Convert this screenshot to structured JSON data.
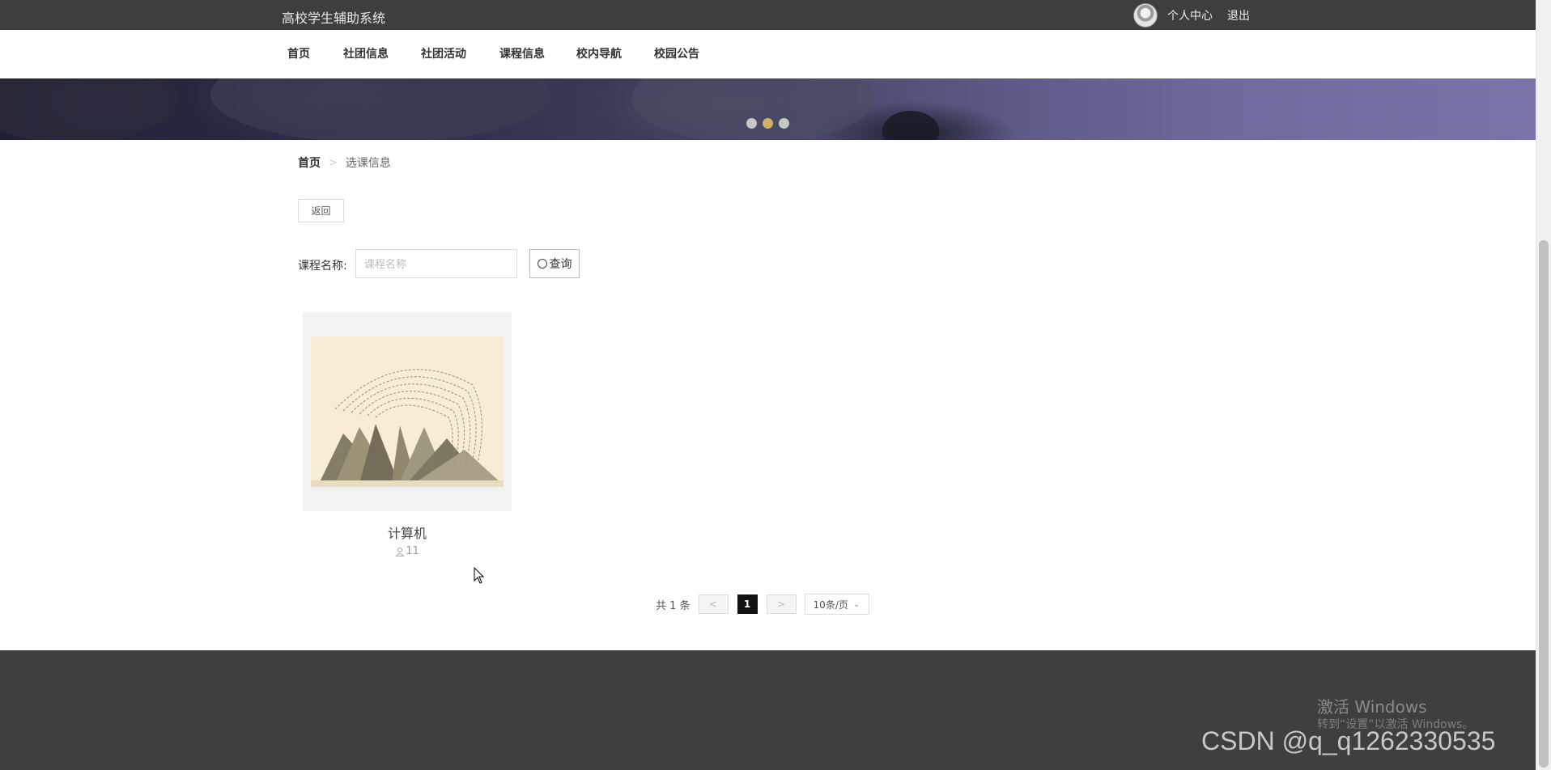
{
  "header": {
    "site_title": "高校学生辅助系统",
    "personal_center": "个人中心",
    "logout": "退出"
  },
  "nav": {
    "items": [
      "首页",
      "社团信息",
      "社团活动",
      "课程信息",
      "校内导航",
      "校园公告"
    ]
  },
  "carousel": {
    "slide_count": 3,
    "active_index": 1
  },
  "breadcrumb": {
    "home": "首页",
    "current": "选课信息"
  },
  "back_button": "返回",
  "search": {
    "label": "课程名称:",
    "placeholder": "课程名称",
    "value": "",
    "button_label": "查询"
  },
  "courses": [
    {
      "title": "计算机",
      "count": "11"
    }
  ],
  "pagination": {
    "total_text": "共 1 条",
    "prev": "<",
    "next": ">",
    "current_page": "1",
    "page_size": "10条/页"
  },
  "watermarks": {
    "activate_line1": "激活 Windows",
    "activate_line2": "转到“设置”以激活 Windows。",
    "csdn": "CSDN @q_q1262330535"
  },
  "colors": {
    "topbar": "#3e3e3e",
    "footer": "#3f3f3f",
    "active_page": "#111111",
    "active_dot": "#d2b06a"
  }
}
